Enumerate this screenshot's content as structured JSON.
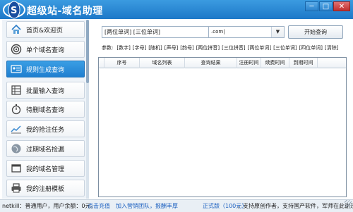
{
  "window": {
    "title": "超级站-域名助理",
    "controls": [
      "minimize-icon",
      "maximize-icon",
      "close-icon"
    ]
  },
  "sidebar": {
    "items": [
      {
        "label": "首页&欢迎页",
        "icon": "home-icon"
      },
      {
        "label": "单个域名查询",
        "icon": "target-icon"
      },
      {
        "label": "规则生成查询",
        "icon": "id-card-icon",
        "active": true
      },
      {
        "label": "批量输入查询",
        "icon": "grid-list-icon"
      },
      {
        "label": "待删域名查询",
        "icon": "stopwatch-icon"
      },
      {
        "label": "我的抢注任务",
        "icon": "chart-icon"
      },
      {
        "label": "过期域名捡漏",
        "icon": "globe-icon"
      },
      {
        "label": "我的域名管理",
        "icon": "window-icon"
      },
      {
        "label": "我的注册模板",
        "icon": "printer-icon"
      }
    ]
  },
  "form": {
    "word_select": "[两位单词] [三位单词]",
    "suffix_value": ".com|",
    "dropdown_glyph": "▼",
    "start_button": "开始查询",
    "params_label": "参数:",
    "params": [
      "[数字]",
      "[字母]",
      "[随机]",
      "[声母]",
      "[韵母]",
      "[两位拼音]",
      "[三位拼音]",
      "[两位单词]",
      "[三位单词]",
      "[四位单词]",
      "[清除]"
    ]
  },
  "table": {
    "columns": [
      "序号",
      "域名列表",
      "查询结果",
      "注册时间",
      "续费时间",
      "到期时间"
    ],
    "rows": []
  },
  "statusbar": {
    "user": "netkill：普通用户，用户余额：0元。",
    "recharge": "点击充值",
    "join": "加入营销团队，报酬丰厚",
    "version": "正式版（100元）",
    "notice": "，支持原创作者，支持国产软件，军师在此谢过。"
  },
  "colors": {
    "titlebar": "#2a86d4",
    "active_nav": "#2a8ad8",
    "link": "#1a5fc0"
  }
}
